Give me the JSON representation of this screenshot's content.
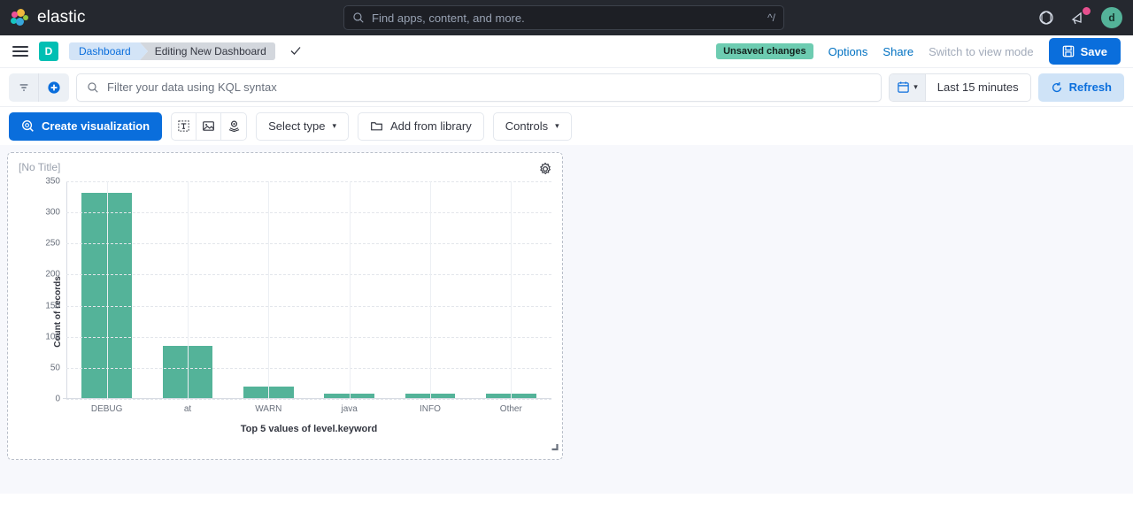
{
  "header": {
    "brand_name": "elastic",
    "search": {
      "placeholder": "Find apps, content, and more.",
      "shortcut": "^/"
    },
    "help_icon": "help-globe-icon",
    "news_icon": "announcement-icon",
    "avatar_initial": "d"
  },
  "breadcrumb_bar": {
    "menu_icon": "hamburger-menu-icon",
    "app_badge": "D",
    "crumbs": [
      {
        "label": "Dashboard"
      },
      {
        "label": "Editing New Dashboard"
      }
    ],
    "check_icon": "checkmark-icon",
    "unsaved_badge": "Unsaved changes",
    "options_label": "Options",
    "share_label": "Share",
    "view_mode_label": "Switch to view mode",
    "save_label": "Save"
  },
  "query_bar": {
    "filter_icon": "filter-icon",
    "add_filter_icon": "add-filter-plus-icon",
    "kql_placeholder": "Filter your data using KQL syntax",
    "date_range": "Last 15 minutes",
    "refresh_label": "Refresh"
  },
  "toolbar": {
    "create_label": "Create visualization",
    "icon_buttons": [
      "text-panel-icon",
      "image-panel-icon",
      "map-panel-icon"
    ],
    "select_type_label": "Select type",
    "add_from_library_label": "Add from library",
    "controls_label": "Controls"
  },
  "panel": {
    "title": "[No Title]",
    "gear_icon": "panel-settings-gear-icon",
    "resize_icon": "resize-handle-icon"
  },
  "chart_data": {
    "type": "bar",
    "title": "",
    "xlabel": "Top 5 values of level.keyword",
    "ylabel": "Count of records",
    "categories": [
      "DEBUG",
      "at",
      "WARN",
      "java",
      "INFO",
      "Other"
    ],
    "values": [
      330,
      84,
      18,
      7,
      7,
      7
    ],
    "ylim": [
      0,
      350
    ],
    "yticks": [
      0,
      50,
      100,
      150,
      200,
      250,
      300,
      350
    ],
    "grid": true,
    "legend": "none",
    "bar_color": "#54b399"
  },
  "colors": {
    "accent_blue": "#0a6edc",
    "brand_teal": "#00bfb3",
    "bar_green": "#54b399",
    "unsaved_green": "#6dccb1"
  }
}
